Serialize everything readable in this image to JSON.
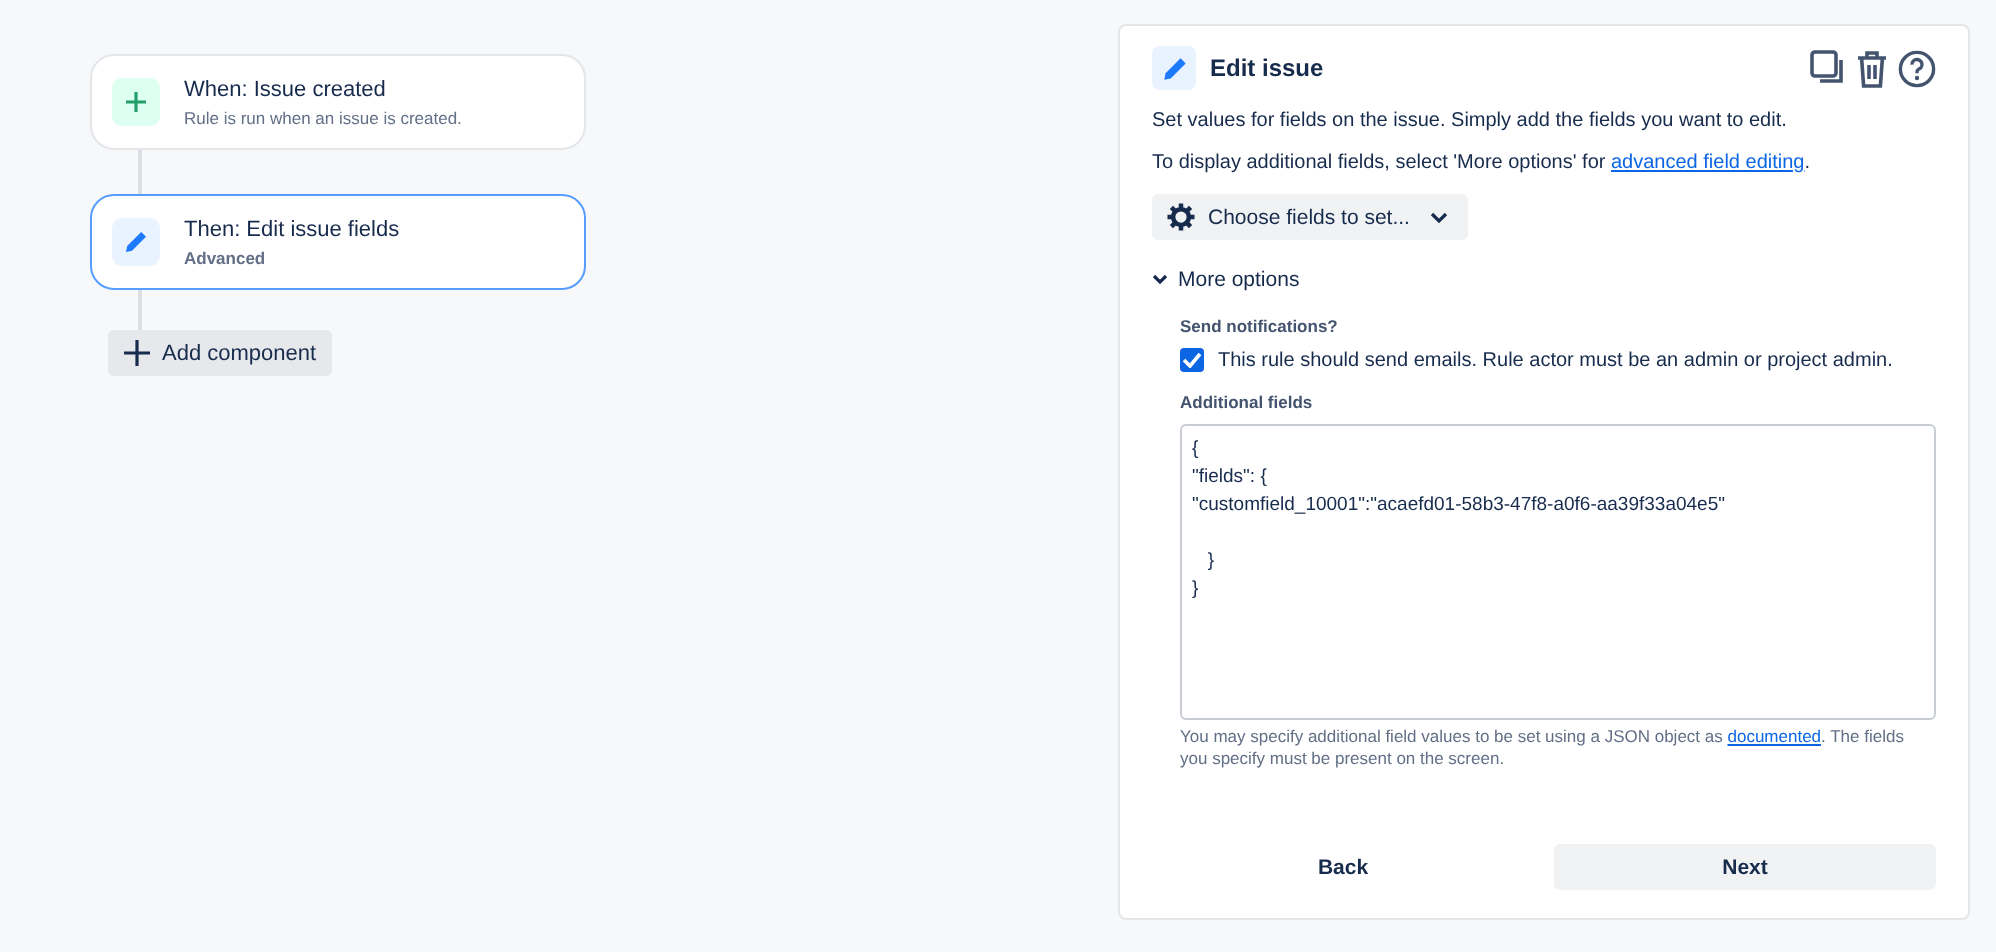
{
  "flow": {
    "components": [
      {
        "kind": "trigger",
        "title": "When: Issue created",
        "subtitle": "Rule is run when an issue is created.",
        "selected": false
      },
      {
        "kind": "action",
        "title": "Then: Edit issue fields",
        "subtitle": "Advanced",
        "selected": true
      }
    ],
    "add_button": "Add component"
  },
  "panel": {
    "title": "Edit issue",
    "description": "Set values for fields on the issue. Simply add the fields you want to edit.",
    "hint": {
      "before": "To display additional fields, select 'More options' for ",
      "link": "advanced field editing",
      "after": "."
    },
    "choose_button": "Choose fields to set...",
    "more_options": {
      "label": "More options",
      "expanded": true
    },
    "notifications": {
      "label": "Send notifications?",
      "checkbox": "This rule should send emails. Rule actor must be an admin or project admin.",
      "checked": true
    },
    "additional_fields": {
      "label": "Additional fields",
      "value": "{\n\"fields\": {\n\"customfield_10001\":\"acaefd01-58b3-47f8-a0f6-aa39f33a04e5\"\n\n   }\n}",
      "help": {
        "before": "You may specify additional field values to be set using a JSON object as ",
        "link": "documented",
        "after": ". The fields you specify must be present on the screen."
      }
    },
    "buttons": {
      "back": "Back",
      "next": "Next"
    }
  }
}
